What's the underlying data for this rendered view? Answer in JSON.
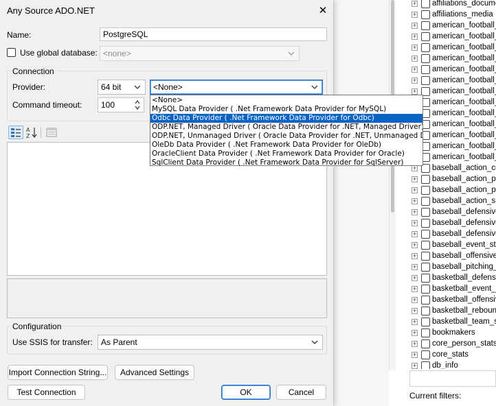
{
  "dialog": {
    "title": "Any Source ADO.NET",
    "close_glyph": "✕",
    "name_label": "Name:",
    "name_value": "PostgreSQL",
    "use_global_label": "Use global database:",
    "use_global_value": "<none>",
    "connection_group": "Connection",
    "provider_label": "Provider:",
    "bitness_value": "64 bit",
    "provider_value": "<None>",
    "command_timeout_label": "Command timeout:",
    "command_timeout_value": "100",
    "configuration_group": "Configuration",
    "ssis_label": "Use SSIS for transfer:",
    "ssis_value": "As Parent",
    "import_button": "Import Connection String...",
    "advanced_button": "Advanced Settings",
    "test_button": "Test Connection",
    "ok_button": "OK",
    "cancel_button": "Cancel"
  },
  "provider_options": [
    {
      "label": "<None>",
      "selected": false
    },
    {
      "label": "MySQL Data Provider ( .Net Framework Data Provider for MySQL)",
      "selected": false
    },
    {
      "label": "Odbc Data Provider ( .Net Framework Data Provider for Odbc)",
      "selected": true
    },
    {
      "label": "ODP.NET, Managed Driver ( Oracle Data Provider for .NET, Managed Driver)",
      "selected": false
    },
    {
      "label": "ODP.NET, Unmanaged Driver ( Oracle Data Provider for .NET, Unmanaged Driver)",
      "selected": false
    },
    {
      "label": "OleDb Data Provider ( .Net Framework Data Provider for OleDb)",
      "selected": false
    },
    {
      "label": "OracleClient Data Provider ( .Net Framework Data Provider for Oracle)",
      "selected": false
    },
    {
      "label": "SqlClient Data Provider ( .Net Framework Data Provider for SqlServer)",
      "selected": false
    }
  ],
  "tree": {
    "items": [
      "affiliations_documer",
      "affiliations_media",
      "american_football_a",
      "american_football_a",
      "american_football_d",
      "american_football_d",
      "american_football_e",
      "american_football_fu",
      "american_football_o",
      "american_football_p",
      "american_football_p",
      "american_football_ru",
      "american_football_s",
      "american_football_s",
      "american_football_s",
      "baseball_action_con",
      "baseball_action_pitc",
      "baseball_action_play",
      "baseball_action_sub",
      "baseball_defensive_",
      "baseball_defensive_",
      "baseball_defensive_",
      "baseball_event_stat",
      "baseball_offensive_",
      "baseball_pitching_st",
      "basketball_defensiv",
      "basketball_event_st",
      "basketball_offensive",
      "basketball_reboundi",
      "basketball_team_sta",
      "bookmakers",
      "core_person_stats",
      "core_stats",
      "db_info"
    ],
    "current_filters_label": "Current filters:"
  },
  "colors": {
    "selection": "#0a64c8",
    "focus_border": "#2b6cc4"
  }
}
